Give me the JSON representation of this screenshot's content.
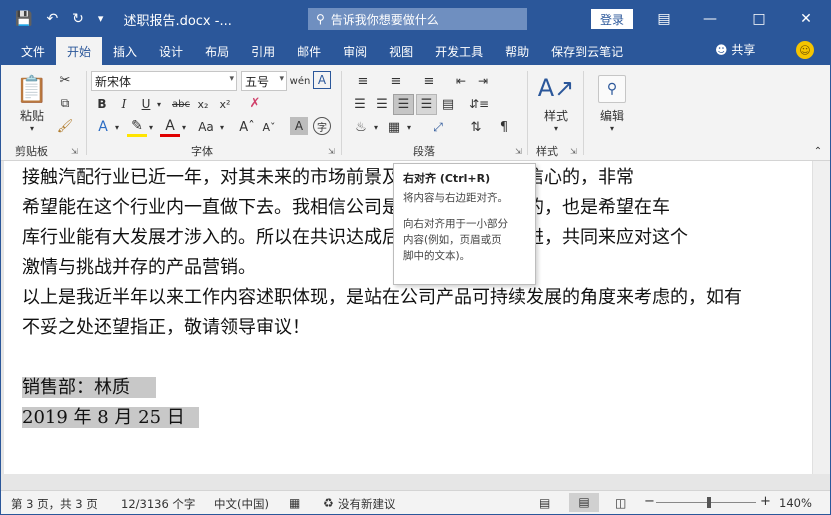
{
  "titlebar": {
    "doc_title": "述职报告.docx  -...",
    "tell_me": "告诉我你想要做什么",
    "login": "登录"
  },
  "tabs": [
    "文件",
    "开始",
    "插入",
    "设计",
    "布局",
    "引用",
    "邮件",
    "审阅",
    "视图",
    "开发工具",
    "帮助",
    "保存到云笔记"
  ],
  "active_tab": "开始",
  "share": "共享",
  "ribbon": {
    "clipboard": {
      "paste": "粘贴",
      "label": "剪贴板"
    },
    "font": {
      "name": "新宋体",
      "size": "五号",
      "label": "字体"
    },
    "paragraph": {
      "label": "段落"
    },
    "styles": {
      "button": "样式",
      "label": "样式"
    },
    "editing": {
      "button": "编辑"
    }
  },
  "tooltip": {
    "title": "右对齐 (Ctrl+R)",
    "line1": "将内容与右边距对齐。",
    "line2": "向右对齐用于一小部分",
    "line3": "内容(例如，页眉或页",
    "line4": "脚中的文本)。"
  },
  "document": {
    "lines": [
      "接触汽配行业已近一年，对其未来的市场前景及行业发展是很有信心的，非常",
      "希望能在这个行业内一直做下去。我相信公司是一个前景型行业的，也是希望在车",
      "库行业能有大发展才涉入的。所以在共识达成后，更需要携心同进，共同来应对这个",
      "激情与挑战并存的产品营销。",
      "以上是我近半年以来工作内容述职体现，是站在公司产品可持续发展的角度来考虑的，如有",
      "不妥之处还望指正，敬请领导审议！"
    ],
    "signature": "销售部：林质",
    "date": "2019 年 8 月 25 日"
  },
  "status": {
    "page": "第 3 页，共 3 页",
    "words": "12/3136 个字",
    "language": "中文(中国)",
    "suggestion": "没有新建议",
    "zoom": "140%"
  }
}
